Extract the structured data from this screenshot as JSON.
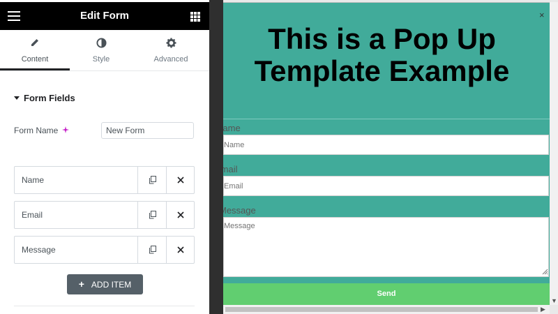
{
  "editor": {
    "title": "Edit Form",
    "tabs": [
      {
        "label": "Content",
        "icon": "pencil-icon",
        "active": true
      },
      {
        "label": "Style",
        "icon": "contrast-icon",
        "active": false
      },
      {
        "label": "Advanced",
        "icon": "gear-icon",
        "active": false
      }
    ],
    "section_title": "Form Fields",
    "form_name_label": "Form Name",
    "form_name_value": "New Form",
    "items": [
      {
        "label": "Name"
      },
      {
        "label": "Email"
      },
      {
        "label": "Message"
      }
    ],
    "add_item_label": "ADD ITEM"
  },
  "popup": {
    "heading": "This is a Pop Up Template Example",
    "close": "×",
    "fields": [
      {
        "label": "Name",
        "placeholder": "Name"
      },
      {
        "label": "Email",
        "placeholder": "Email"
      },
      {
        "label": "Message",
        "placeholder": "Message"
      }
    ],
    "send_label": "Send",
    "colors": {
      "background": "#41ab9a",
      "button": "#61ce70"
    }
  }
}
